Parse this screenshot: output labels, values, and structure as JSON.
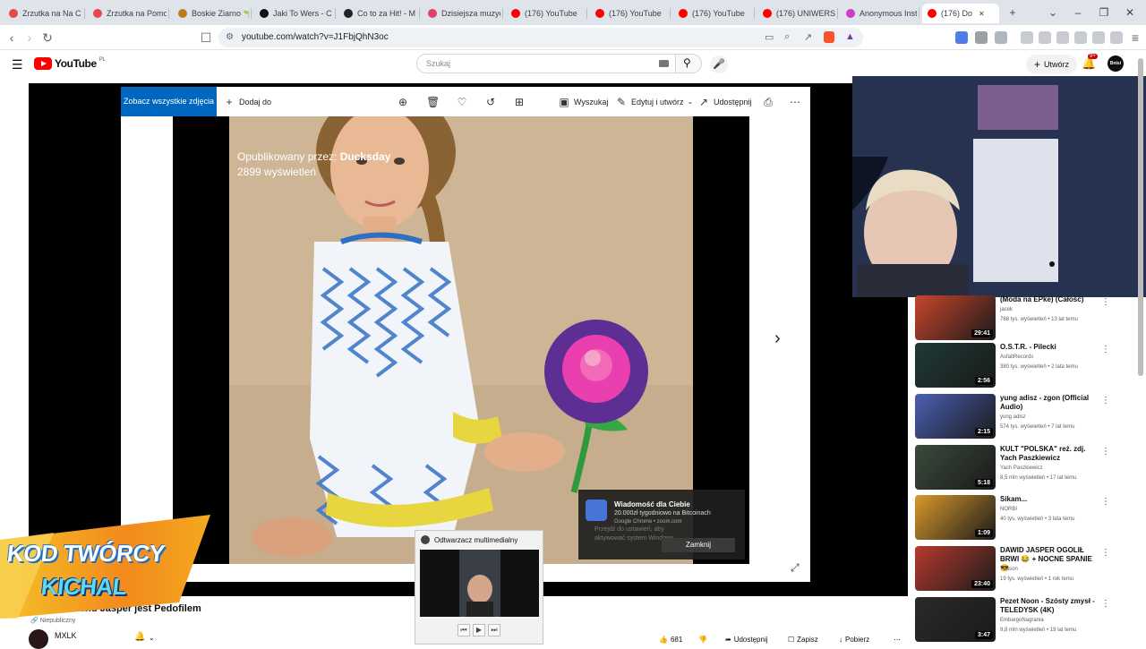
{
  "browser": {
    "tabs": [
      {
        "label": "Zrzutka na Na C",
        "color": "#e5484d"
      },
      {
        "label": "Zrzutka na Pomo",
        "color": "#e5484d"
      },
      {
        "label": "Boskie Ziarno 🌱",
        "color": "#c07a1a"
      },
      {
        "label": "Jaki To Wers - C",
        "color": "#111111"
      },
      {
        "label": "Co to za Hit! - M",
        "color": "#222222"
      },
      {
        "label": "Dzisiejsza muzyc",
        "color": "#e0406e"
      },
      {
        "label": "(176) YouTube",
        "color": "#ff0000"
      },
      {
        "label": "(176) YouTube",
        "color": "#ff0000"
      },
      {
        "label": "(176) YouTube",
        "color": "#ff0000"
      },
      {
        "label": "(176) UNIWERSU",
        "color": "#ff0000"
      },
      {
        "label": "Anonymous Inst",
        "color": "#d03cc7"
      },
      {
        "label": "(176) Do",
        "color": "#ff0000"
      }
    ],
    "url": "youtube.com/watch?v=J1FbjQhN3oc"
  },
  "youtube": {
    "logo_text": "YouTube",
    "logo_region": "PL",
    "search_placeholder": "Szukaj",
    "create_label": "Utwórz",
    "notifications_badge": "9+",
    "avatar_text": "Bnisi"
  },
  "viewer": {
    "see_all": "Zobacz wszystkie zdjęcia",
    "add_to": "Dodaj do",
    "search": "Wyszukaj",
    "edit_create": "Edytuj i utwórz",
    "share": "Udostępnij",
    "posted_by_prefix": "Opublikowany przez: ",
    "posted_by_name": "Ducksday",
    "views": "2899 wyświetleń"
  },
  "notification": {
    "title": "Wiadomość dla Ciebie",
    "line1": "20.000zł tygodniowo na Bitcoinach",
    "line2": "Google Chrome • zoom.com",
    "ghost": "Przejdź do ustawień, aby aktywować system Windows.",
    "close": "Zamknij"
  },
  "media_player": {
    "title": "Odtwarzacz multimedialny"
  },
  "video": {
    "title": "y 15, że Dawid Jasper jest Pedofilem",
    "visibility": "Niepubliczny",
    "channel": "MXLK",
    "likes": "681",
    "share": "Udostępnij",
    "save": "Zapisz",
    "download": "Pobierz"
  },
  "banner": {
    "line1": "KOD TWÓRCY",
    "line2": "KICHAL"
  },
  "sidebar": [
    {
      "title": "(Moda na EPke) (Całość)",
      "channel": "jacek",
      "meta": "768 tys. wyświetleń • 13 lat temu",
      "duration": "29:41",
      "thumb": "#c8452c"
    },
    {
      "title": "O.S.T.R. - Pilecki",
      "channel": "AsfaltRecords",
      "meta": "380 tys. wyświetleń • 2 lata temu",
      "duration": "2:56",
      "thumb": "#1f3a36"
    },
    {
      "title": "yung adisz - zgon (Official Audio)",
      "channel": "yung adisz",
      "meta": "574 tys. wyświetleń • 7 lat temu",
      "duration": "2:15",
      "thumb": "#4b5fb3"
    },
    {
      "title": "KULT \"POLSKA\" reż. zdj. Yach Paszkiewicz",
      "channel": "Yach Paszkiewicz",
      "meta": "8,5 mln wyświetleń • 17 lat temu",
      "duration": "5:18",
      "thumb": "#3a4a3c"
    },
    {
      "title": "Sikam...",
      "channel": "NORBI",
      "meta": "40 tys. wyświetleń • 3 lata temu",
      "duration": "1:09",
      "thumb": "#d99a2b"
    },
    {
      "title": "DAWID JASPER OGOLIŁ BRWI 😂 + NOCNE SPANIE 😎",
      "channel": "Tubson",
      "meta": "19 tys. wyświetleń • 1 rok temu",
      "duration": "23:40",
      "thumb": "#b83a2e"
    },
    {
      "title": "Pezet Noon - Szósty zmysł - TELEDYSK (4K)",
      "channel": "EmbargoNagrania",
      "meta": "9,8 mln wyświetleń • 19 lat temu",
      "duration": "3:47",
      "thumb": "#2a2a2a"
    }
  ]
}
